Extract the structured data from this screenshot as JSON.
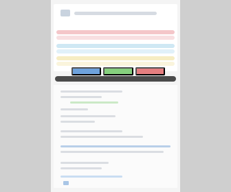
{
  "colors": {
    "background": "#cfcfcf",
    "panel": "#f4f4f4",
    "card": "#ffffff",
    "accent_blue": "#6ea2dc",
    "accent_green": "#86cf7e",
    "accent_red": "#e57f80",
    "toolbar": "#4a4a4a"
  },
  "icons": {
    "app_logo": "logo-icon",
    "bottom_icon": "blue-square-icon"
  },
  "buttons": {
    "blue": "",
    "green": "",
    "red": ""
  }
}
